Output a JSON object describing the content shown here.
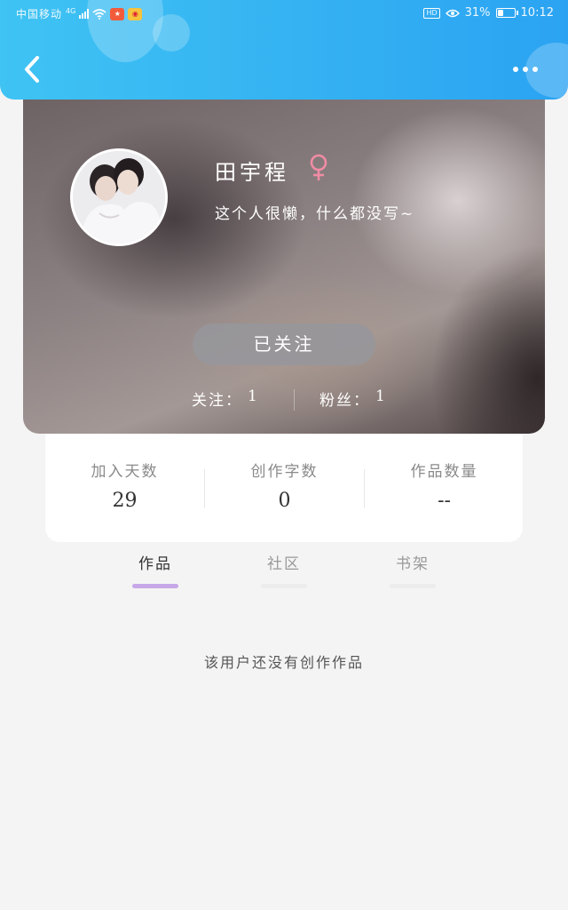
{
  "status_bar": {
    "carrier": "中国移动",
    "network": "4G",
    "battery_text": "31%",
    "battery_level": 0.31,
    "time": "10:12"
  },
  "header": {
    "back_icon": "chevron-left-icon",
    "more_icon": "more-dots-icon",
    "gradient_start": "#3fc3f3",
    "gradient_end": "#2ba3f2"
  },
  "profile": {
    "username": "田宇程",
    "gender_icon": "female-symbol-icon",
    "gender_color": "#f08ca4",
    "bio": "这个人很懒，什么都没写~",
    "follow_button_label": "已关注",
    "following_label": "关注：",
    "following_count": "1",
    "fans_label": "粉丝：",
    "fans_count": "1"
  },
  "stats": [
    {
      "label": "加入天数",
      "value": "29"
    },
    {
      "label": "创作字数",
      "value": "0"
    },
    {
      "label": "作品数量",
      "value": "--"
    }
  ],
  "tabs": [
    {
      "label": "作品",
      "active": true
    },
    {
      "label": "社区",
      "active": false
    },
    {
      "label": "书架",
      "active": false
    }
  ],
  "empty_state": "该用户还没有创作作品",
  "accent_color": "#c6a8e8"
}
